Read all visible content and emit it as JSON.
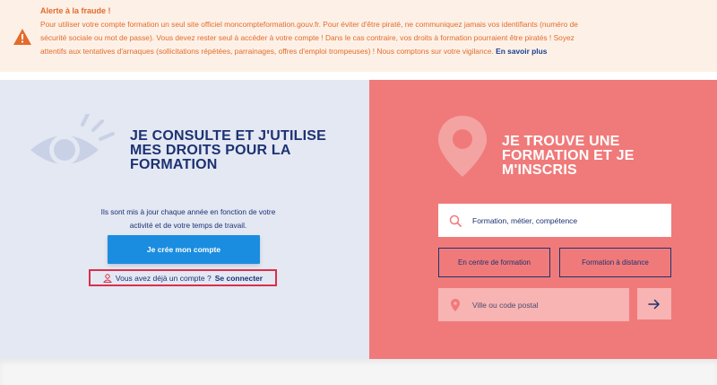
{
  "alert": {
    "title": "Alerte à la fraude !",
    "body": "Pour utiliser votre compte formation un seul site officiel moncompteformation.gouv.fr. Pour éviter d'être piraté, ne communiquez jamais vos identifiants (numéro de sécurité sociale ou mot de passe). Vous devez rester seul à accéder à votre compte ! Dans le cas contraire, vos droits à formation pourraient être piratés ! Soyez attentifs aux tentatives d'arnaques (sollicitations répétées, parrainages, offres d'emploi trompeuses) ! Nous comptons sur votre vigilance.",
    "link_label": "En savoir plus",
    "icon": "warning-icon",
    "color": "#e36b2c"
  },
  "left": {
    "heading": "JE CONSULTE ET J'UTILISE MES DROITS POUR LA FORMATION",
    "description": "Ils sont mis à jour chaque année en fonction de votre activité et de votre temps de travail.",
    "create_button": "Je crée mon compte",
    "login_prompt": "Vous avez déjà un compte ?",
    "login_link": "Se connecter",
    "icon": "eye-icon",
    "background": "#e4e8f3",
    "accent": "#1a8de0"
  },
  "right": {
    "heading": "JE TROUVE UNE FORMATION ET JE M'INSCRIS",
    "search_placeholder": "Formation, métier, compétence",
    "option_center": "En centre de formation",
    "option_distance": "Formation à distance",
    "location_placeholder": "Ville ou code postal",
    "icon": "location-pin-icon",
    "background": "#f07a7a"
  }
}
